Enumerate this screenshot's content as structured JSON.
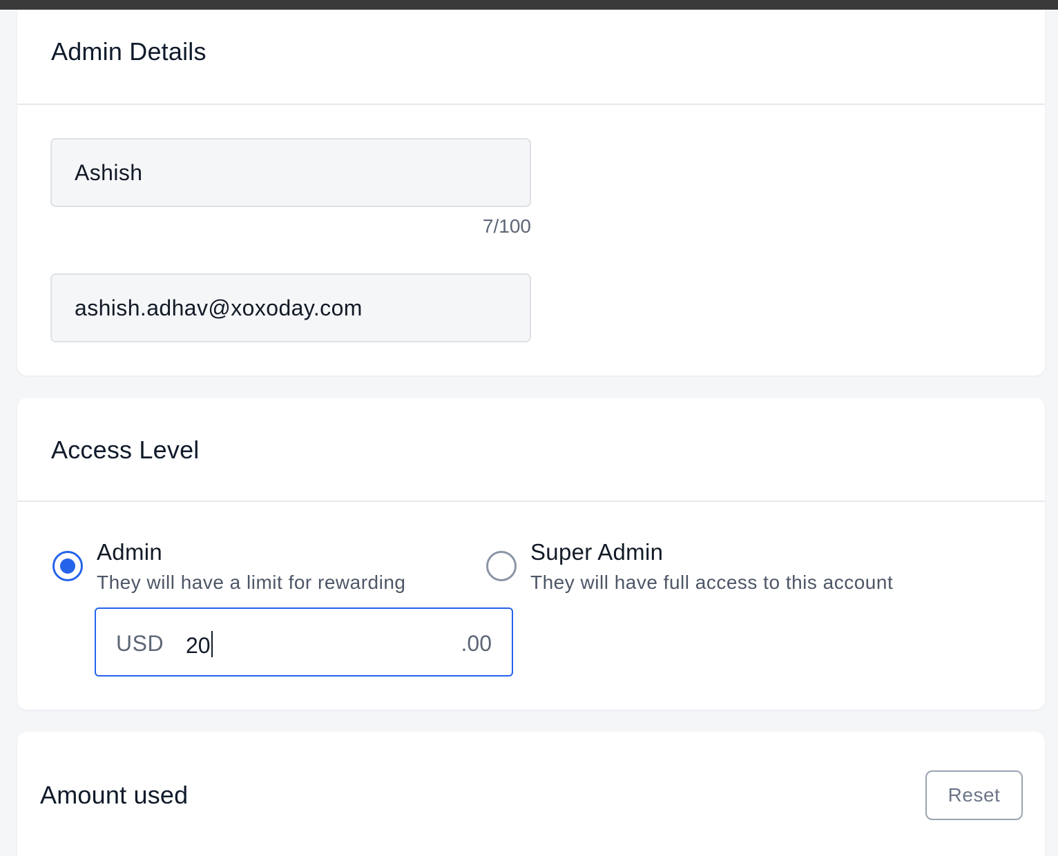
{
  "admin_details": {
    "title": "Admin Details",
    "name_value": "Ashish",
    "name_char_count": "7/100",
    "email_value": "ashish.adhav@xoxoday.com"
  },
  "access_level": {
    "title": "Access Level",
    "options": [
      {
        "label": "Admin",
        "description": "They will have a limit for rewarding",
        "selected": true
      },
      {
        "label": "Super Admin",
        "description": "They will have full access to this account",
        "selected": false
      }
    ],
    "limit": {
      "currency": "USD",
      "value": "20",
      "decimals": ".00"
    }
  },
  "amount_used": {
    "title": "Amount used",
    "reset_label": "Reset"
  },
  "colors": {
    "accent": "#2563eb",
    "page_bg": "#f5f6f8",
    "top_bar": "#3a3a3a"
  }
}
